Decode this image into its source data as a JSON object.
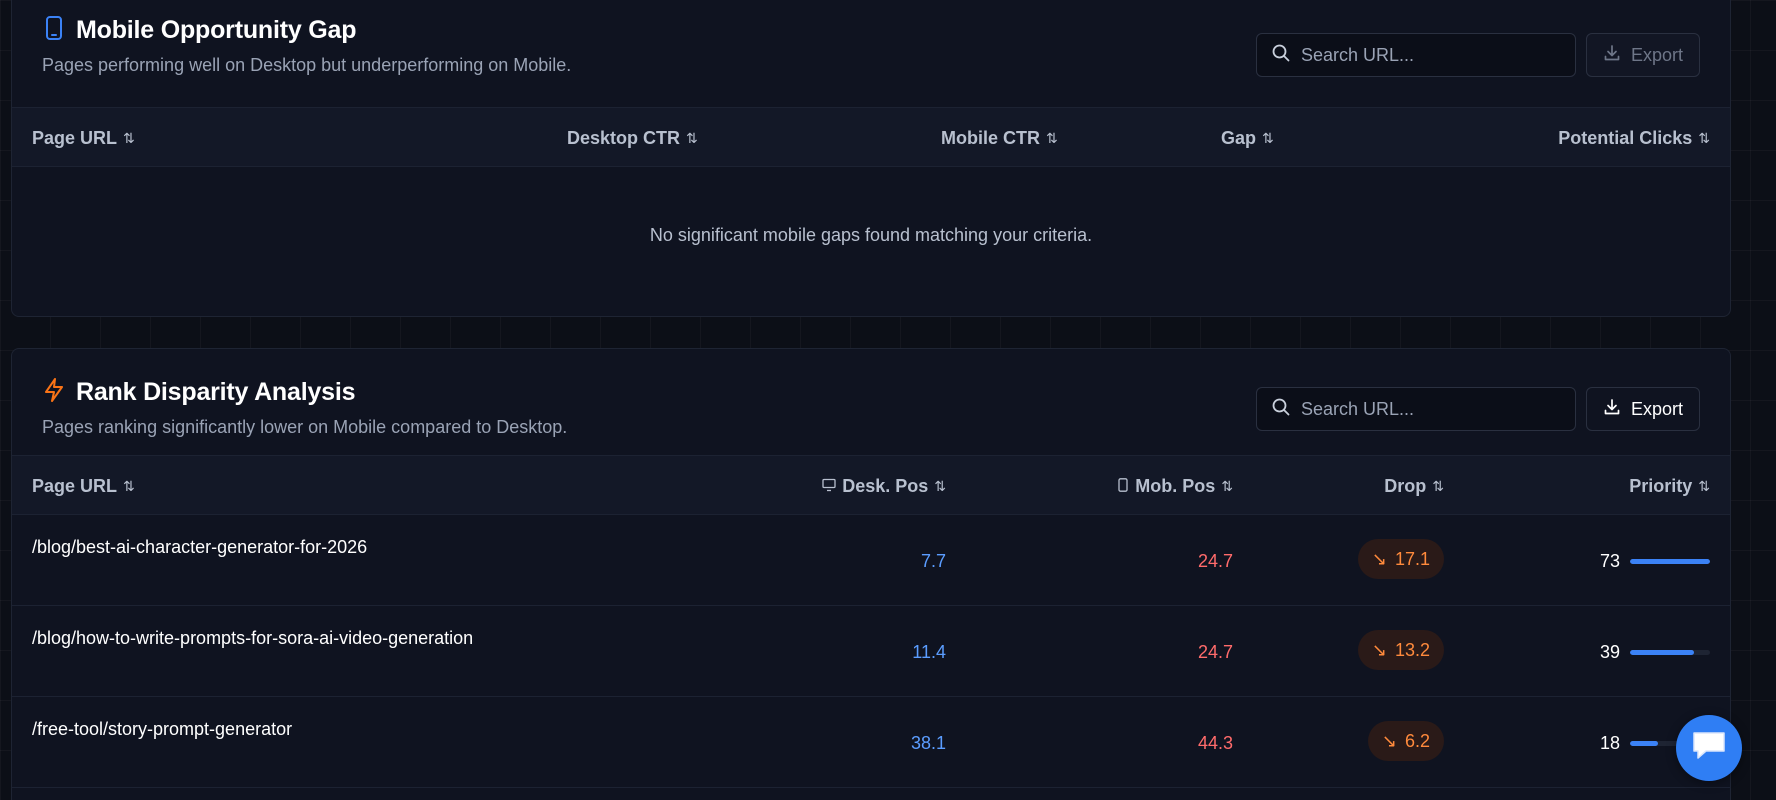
{
  "mobile_gap": {
    "title": "Mobile Opportunity Gap",
    "subtitle": "Pages performing well on Desktop but underperforming on Mobile.",
    "search_placeholder": "Search URL...",
    "export_label": "Export",
    "columns": [
      "Page URL",
      "Desktop CTR",
      "Mobile CTR",
      "Gap",
      "Potential Clicks"
    ],
    "empty_message": "No significant mobile gaps found matching your criteria.",
    "icon": "smartphone-icon",
    "accent": "#3b82f6"
  },
  "rank_disparity": {
    "title": "Rank Disparity Analysis",
    "subtitle": "Pages ranking significantly lower on Mobile compared to Desktop.",
    "search_placeholder": "Search URL...",
    "export_label": "Export",
    "columns": [
      "Page URL",
      "Desk. Pos",
      "Mob. Pos",
      "Drop",
      "Priority"
    ],
    "icon": "lightning-icon",
    "accent": "#f97316",
    "rows": [
      {
        "url": "/blog/best-ai-character-generator-for-2026",
        "desk_pos": "7.7",
        "mob_pos": "24.7",
        "drop": "17.1",
        "priority": "73",
        "priority_fraction": 1.0
      },
      {
        "url": "/blog/how-to-write-prompts-for-sora-ai-video-generation",
        "desk_pos": "11.4",
        "mob_pos": "24.7",
        "drop": "13.2",
        "priority": "39",
        "priority_fraction": 0.8
      },
      {
        "url": "/free-tool/story-prompt-generator",
        "desk_pos": "38.1",
        "mob_pos": "44.3",
        "drop": "6.2",
        "priority": "18",
        "priority_fraction": 0.35
      }
    ]
  },
  "colors": {
    "desk_pos": "#5b9dff",
    "mob_pos": "#ff6b6b",
    "drop": "#ff8a3c",
    "bar": "#3b82f6"
  }
}
